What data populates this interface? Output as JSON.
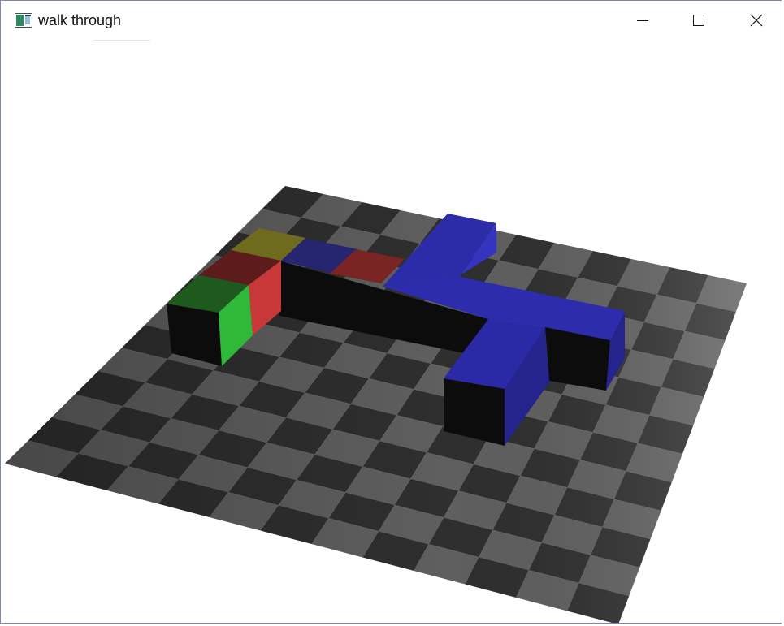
{
  "window": {
    "title": "walk through",
    "controls": [
      "minimize",
      "maximize",
      "close"
    ]
  },
  "icons": {
    "app": "app-window-icon",
    "minimize": "minimize-icon",
    "maximize": "maximize-icon",
    "close": "close-icon"
  },
  "scene": {
    "floor": {
      "pattern": "checkerboard",
      "dark_color": "#2f2f2f",
      "light_color": "#5f5f5f"
    },
    "blocks": {
      "green_color": "#2fb83a",
      "red_color": "#c83838",
      "yellow_color": "#6e6a1e",
      "blue_color": "#2c2ca8",
      "shadow_color": "#0c0c0c"
    }
  }
}
